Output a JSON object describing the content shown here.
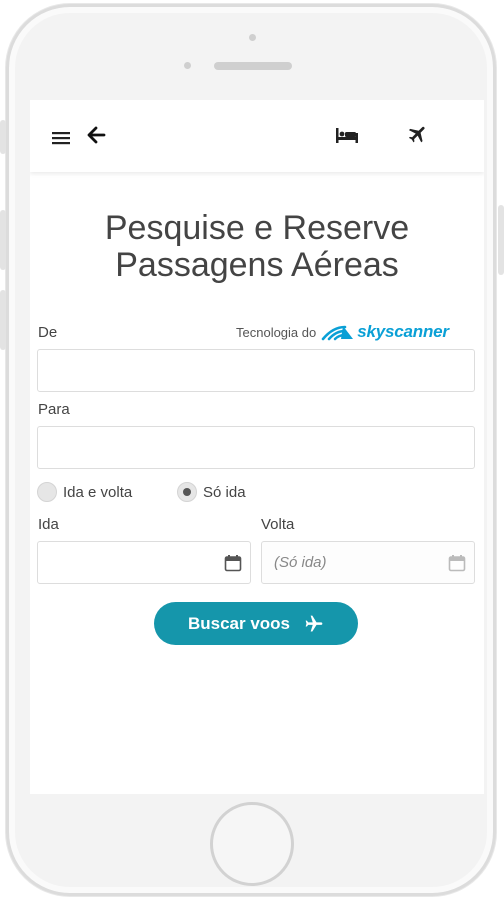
{
  "header": {
    "menu_icon": "hamburger-menu-icon",
    "back_icon": "arrow-left-icon",
    "hotel_icon": "bed-icon",
    "flight_icon": "airplane-icon"
  },
  "main": {
    "title_line1": "Pesquise e Reserve",
    "title_line2": "Passagens Aéreas",
    "powered_by": "Tecnologia do",
    "brand": "skyscanner",
    "from_label": "De",
    "from_value": "",
    "to_label": "Para",
    "to_value": "",
    "trip_options": [
      {
        "label": "Ida e volta",
        "selected": false
      },
      {
        "label": "Só ida",
        "selected": true
      }
    ],
    "depart_label": "Ida",
    "depart_value": "",
    "return_label": "Volta",
    "return_placeholder": "(Só ida)",
    "search_button": "Buscar voos"
  },
  "colors": {
    "accent": "#1596ab",
    "brand": "#0aa0d6"
  }
}
